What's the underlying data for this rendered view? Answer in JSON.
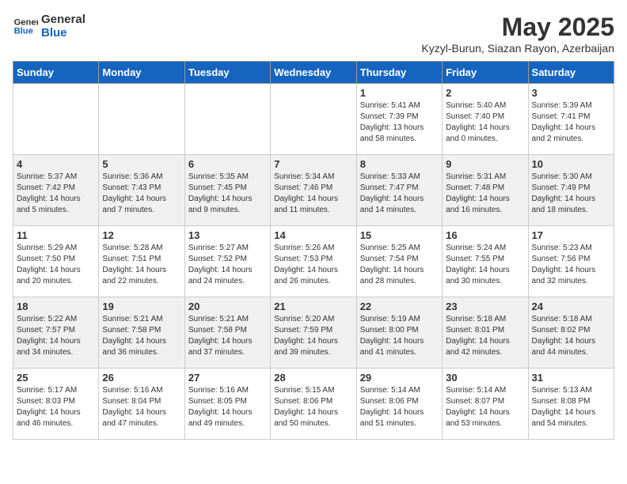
{
  "header": {
    "logo_general": "General",
    "logo_blue": "Blue",
    "title": "May 2025",
    "subtitle": "Kyzyl-Burun, Siazan Rayon, Azerbaijan"
  },
  "columns": [
    "Sunday",
    "Monday",
    "Tuesday",
    "Wednesday",
    "Thursday",
    "Friday",
    "Saturday"
  ],
  "weeks": [
    [
      {
        "day": "",
        "sunrise": "",
        "sunset": "",
        "daylight": ""
      },
      {
        "day": "",
        "sunrise": "",
        "sunset": "",
        "daylight": ""
      },
      {
        "day": "",
        "sunrise": "",
        "sunset": "",
        "daylight": ""
      },
      {
        "day": "",
        "sunrise": "",
        "sunset": "",
        "daylight": ""
      },
      {
        "day": "1",
        "sunrise": "Sunrise: 5:41 AM",
        "sunset": "Sunset: 7:39 PM",
        "daylight": "Daylight: 13 hours and 58 minutes."
      },
      {
        "day": "2",
        "sunrise": "Sunrise: 5:40 AM",
        "sunset": "Sunset: 7:40 PM",
        "daylight": "Daylight: 14 hours and 0 minutes."
      },
      {
        "day": "3",
        "sunrise": "Sunrise: 5:39 AM",
        "sunset": "Sunset: 7:41 PM",
        "daylight": "Daylight: 14 hours and 2 minutes."
      }
    ],
    [
      {
        "day": "4",
        "sunrise": "Sunrise: 5:37 AM",
        "sunset": "Sunset: 7:42 PM",
        "daylight": "Daylight: 14 hours and 5 minutes."
      },
      {
        "day": "5",
        "sunrise": "Sunrise: 5:36 AM",
        "sunset": "Sunset: 7:43 PM",
        "daylight": "Daylight: 14 hours and 7 minutes."
      },
      {
        "day": "6",
        "sunrise": "Sunrise: 5:35 AM",
        "sunset": "Sunset: 7:45 PM",
        "daylight": "Daylight: 14 hours and 9 minutes."
      },
      {
        "day": "7",
        "sunrise": "Sunrise: 5:34 AM",
        "sunset": "Sunset: 7:46 PM",
        "daylight": "Daylight: 14 hours and 11 minutes."
      },
      {
        "day": "8",
        "sunrise": "Sunrise: 5:33 AM",
        "sunset": "Sunset: 7:47 PM",
        "daylight": "Daylight: 14 hours and 14 minutes."
      },
      {
        "day": "9",
        "sunrise": "Sunrise: 5:31 AM",
        "sunset": "Sunset: 7:48 PM",
        "daylight": "Daylight: 14 hours and 16 minutes."
      },
      {
        "day": "10",
        "sunrise": "Sunrise: 5:30 AM",
        "sunset": "Sunset: 7:49 PM",
        "daylight": "Daylight: 14 hours and 18 minutes."
      }
    ],
    [
      {
        "day": "11",
        "sunrise": "Sunrise: 5:29 AM",
        "sunset": "Sunset: 7:50 PM",
        "daylight": "Daylight: 14 hours and 20 minutes."
      },
      {
        "day": "12",
        "sunrise": "Sunrise: 5:28 AM",
        "sunset": "Sunset: 7:51 PM",
        "daylight": "Daylight: 14 hours and 22 minutes."
      },
      {
        "day": "13",
        "sunrise": "Sunrise: 5:27 AM",
        "sunset": "Sunset: 7:52 PM",
        "daylight": "Daylight: 14 hours and 24 minutes."
      },
      {
        "day": "14",
        "sunrise": "Sunrise: 5:26 AM",
        "sunset": "Sunset: 7:53 PM",
        "daylight": "Daylight: 14 hours and 26 minutes."
      },
      {
        "day": "15",
        "sunrise": "Sunrise: 5:25 AM",
        "sunset": "Sunset: 7:54 PM",
        "daylight": "Daylight: 14 hours and 28 minutes."
      },
      {
        "day": "16",
        "sunrise": "Sunrise: 5:24 AM",
        "sunset": "Sunset: 7:55 PM",
        "daylight": "Daylight: 14 hours and 30 minutes."
      },
      {
        "day": "17",
        "sunrise": "Sunrise: 5:23 AM",
        "sunset": "Sunset: 7:56 PM",
        "daylight": "Daylight: 14 hours and 32 minutes."
      }
    ],
    [
      {
        "day": "18",
        "sunrise": "Sunrise: 5:22 AM",
        "sunset": "Sunset: 7:57 PM",
        "daylight": "Daylight: 14 hours and 34 minutes."
      },
      {
        "day": "19",
        "sunrise": "Sunrise: 5:21 AM",
        "sunset": "Sunset: 7:58 PM",
        "daylight": "Daylight: 14 hours and 36 minutes."
      },
      {
        "day": "20",
        "sunrise": "Sunrise: 5:21 AM",
        "sunset": "Sunset: 7:58 PM",
        "daylight": "Daylight: 14 hours and 37 minutes."
      },
      {
        "day": "21",
        "sunrise": "Sunrise: 5:20 AM",
        "sunset": "Sunset: 7:59 PM",
        "daylight": "Daylight: 14 hours and 39 minutes."
      },
      {
        "day": "22",
        "sunrise": "Sunrise: 5:19 AM",
        "sunset": "Sunset: 8:00 PM",
        "daylight": "Daylight: 14 hours and 41 minutes."
      },
      {
        "day": "23",
        "sunrise": "Sunrise: 5:18 AM",
        "sunset": "Sunset: 8:01 PM",
        "daylight": "Daylight: 14 hours and 42 minutes."
      },
      {
        "day": "24",
        "sunrise": "Sunrise: 5:18 AM",
        "sunset": "Sunset: 8:02 PM",
        "daylight": "Daylight: 14 hours and 44 minutes."
      }
    ],
    [
      {
        "day": "25",
        "sunrise": "Sunrise: 5:17 AM",
        "sunset": "Sunset: 8:03 PM",
        "daylight": "Daylight: 14 hours and 46 minutes."
      },
      {
        "day": "26",
        "sunrise": "Sunrise: 5:16 AM",
        "sunset": "Sunset: 8:04 PM",
        "daylight": "Daylight: 14 hours and 47 minutes."
      },
      {
        "day": "27",
        "sunrise": "Sunrise: 5:16 AM",
        "sunset": "Sunset: 8:05 PM",
        "daylight": "Daylight: 14 hours and 49 minutes."
      },
      {
        "day": "28",
        "sunrise": "Sunrise: 5:15 AM",
        "sunset": "Sunset: 8:06 PM",
        "daylight": "Daylight: 14 hours and 50 minutes."
      },
      {
        "day": "29",
        "sunrise": "Sunrise: 5:14 AM",
        "sunset": "Sunset: 8:06 PM",
        "daylight": "Daylight: 14 hours and 51 minutes."
      },
      {
        "day": "30",
        "sunrise": "Sunrise: 5:14 AM",
        "sunset": "Sunset: 8:07 PM",
        "daylight": "Daylight: 14 hours and 53 minutes."
      },
      {
        "day": "31",
        "sunrise": "Sunrise: 5:13 AM",
        "sunset": "Sunset: 8:08 PM",
        "daylight": "Daylight: 14 hours and 54 minutes."
      }
    ]
  ]
}
